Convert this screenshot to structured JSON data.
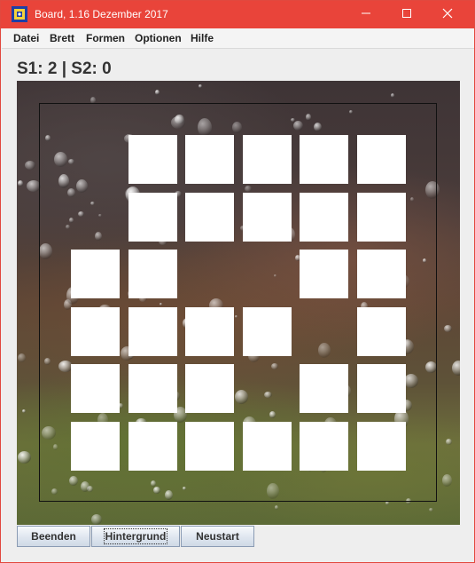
{
  "window": {
    "title": "Board, 1.16 Dezember 2017",
    "title_bar_color": "#e9443a"
  },
  "menu": {
    "items": [
      {
        "label": "Datei"
      },
      {
        "label": "Brett"
      },
      {
        "label": "Formen"
      },
      {
        "label": "Optionen"
      },
      {
        "label": "Hilfe"
      }
    ]
  },
  "score": {
    "text": "S1: 2 | S2: 0"
  },
  "board": {
    "rows": 6,
    "cols": 6,
    "tiles": [
      [
        false,
        true,
        true,
        true,
        true,
        true
      ],
      [
        false,
        true,
        true,
        true,
        true,
        true
      ],
      [
        true,
        true,
        false,
        false,
        true,
        true
      ],
      [
        true,
        true,
        true,
        true,
        false,
        true
      ],
      [
        true,
        true,
        true,
        false,
        true,
        true
      ],
      [
        true,
        true,
        true,
        true,
        true,
        true
      ]
    ],
    "tile_color": "#ffffff",
    "background": "rain-drops-photo"
  },
  "buttons": {
    "quit": "Beenden",
    "background": "Hintergrund",
    "restart": "Neustart"
  },
  "icons": {
    "app": "board-app-icon",
    "minimize": "minimize-icon",
    "maximize": "maximize-icon",
    "close": "close-icon"
  }
}
